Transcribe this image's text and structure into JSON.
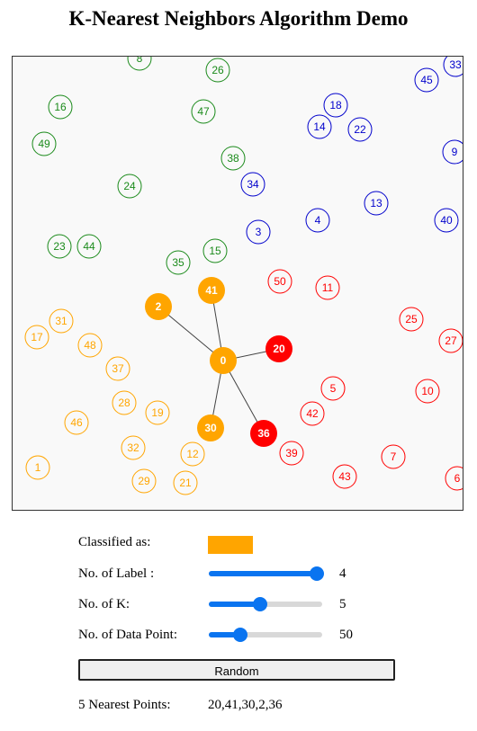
{
  "title": "K-Nearest Neighbors Algorithm Demo",
  "colors": {
    "orange": "#ffa500",
    "red": "#ff0000",
    "blue": "#0000cc",
    "green": "#1a8a1a",
    "line": "#444444"
  },
  "plot": {
    "query": {
      "label": "0",
      "color": "orange"
    },
    "nearest_ids": [
      "20",
      "41",
      "30",
      "2",
      "36"
    ],
    "points": [
      {
        "id": "8",
        "c": "green"
      },
      {
        "id": "26",
        "c": "green"
      },
      {
        "id": "45",
        "c": "blue"
      },
      {
        "id": "33",
        "c": "blue"
      },
      {
        "id": "16",
        "c": "green"
      },
      {
        "id": "47",
        "c": "green"
      },
      {
        "id": "18",
        "c": "blue"
      },
      {
        "id": "14",
        "c": "blue"
      },
      {
        "id": "22",
        "c": "blue"
      },
      {
        "id": "49",
        "c": "green"
      },
      {
        "id": "9",
        "c": "blue"
      },
      {
        "id": "38",
        "c": "green"
      },
      {
        "id": "24",
        "c": "green"
      },
      {
        "id": "34",
        "c": "blue"
      },
      {
        "id": "13",
        "c": "blue"
      },
      {
        "id": "4",
        "c": "blue"
      },
      {
        "id": "40",
        "c": "blue"
      },
      {
        "id": "3",
        "c": "blue"
      },
      {
        "id": "23",
        "c": "green"
      },
      {
        "id": "44",
        "c": "green"
      },
      {
        "id": "15",
        "c": "green"
      },
      {
        "id": "35",
        "c": "green"
      },
      {
        "id": "50",
        "c": "red"
      },
      {
        "id": "11",
        "c": "red"
      },
      {
        "id": "41",
        "c": "orange"
      },
      {
        "id": "2",
        "c": "orange"
      },
      {
        "id": "31",
        "c": "orange"
      },
      {
        "id": "25",
        "c": "red"
      },
      {
        "id": "17",
        "c": "orange"
      },
      {
        "id": "27",
        "c": "red"
      },
      {
        "id": "48",
        "c": "orange"
      },
      {
        "id": "20",
        "c": "red"
      },
      {
        "id": "0",
        "c": "orange"
      },
      {
        "id": "37",
        "c": "orange"
      },
      {
        "id": "5",
        "c": "red"
      },
      {
        "id": "10",
        "c": "red"
      },
      {
        "id": "28",
        "c": "orange"
      },
      {
        "id": "42",
        "c": "red"
      },
      {
        "id": "19",
        "c": "orange"
      },
      {
        "id": "46",
        "c": "orange"
      },
      {
        "id": "30",
        "c": "orange"
      },
      {
        "id": "36",
        "c": "red"
      },
      {
        "id": "32",
        "c": "orange"
      },
      {
        "id": "39",
        "c": "red"
      },
      {
        "id": "12",
        "c": "orange"
      },
      {
        "id": "7",
        "c": "red"
      },
      {
        "id": "1",
        "c": "orange"
      },
      {
        "id": "43",
        "c": "red"
      },
      {
        "id": "29",
        "c": "orange"
      },
      {
        "id": "21",
        "c": "orange"
      },
      {
        "id": "6",
        "c": "red"
      }
    ]
  },
  "controls": {
    "classified_label": "Classified as:",
    "classified_color": "#ffa500",
    "labels_label": "No. of Label :",
    "labels_value": "4",
    "labels_fraction": 0.95,
    "k_label": "No. of K:",
    "k_value": "5",
    "k_fraction": 0.45,
    "points_label": "No. of Data Point:",
    "points_value": "50",
    "points_fraction": 0.28,
    "random_button": "Random",
    "nearest_label": "5 Nearest Points:",
    "nearest_value": "20,41,30,2,36"
  }
}
